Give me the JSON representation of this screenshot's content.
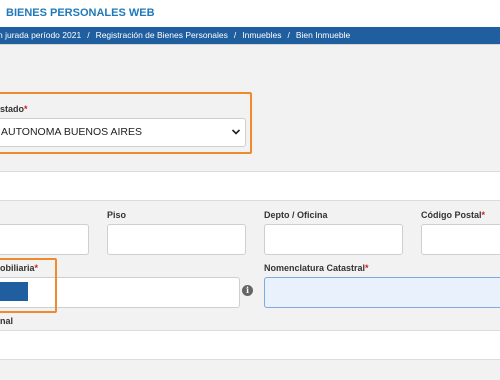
{
  "header": {
    "app_title": "BIENES PERSONALES WEB"
  },
  "breadcrumb": [
    "n jurada período 2021",
    "Registración de Bienes Personales",
    "Inmuebles",
    "Bien Inmueble"
  ],
  "breadcrumb_separator": "/",
  "form": {
    "estado": {
      "label": "stado",
      "required_mark": "*"
    },
    "provincia_select": {
      "value": "AUTONOMA BUENOS AIRES"
    },
    "piso": {
      "label": "Piso",
      "value": ""
    },
    "depto": {
      "label": "Depto / Oficina",
      "value": ""
    },
    "codigo_postal": {
      "label": "Código Postal",
      "required_mark": "*",
      "value": ""
    },
    "partida": {
      "label": "obiliaria",
      "required_mark": "*",
      "value": ""
    },
    "nomenclatura": {
      "label": "Nomenclatura Catastral",
      "required_mark": "*",
      "value": ""
    },
    "nal": {
      "label": "nal",
      "value": ""
    }
  },
  "icons": {
    "chevron": "chevron-down-icon",
    "info": "info-circle-icon",
    "info_glyph": "i"
  },
  "colors": {
    "brand_blue": "#1f5fa0",
    "title_blue": "#1e7ab8",
    "highlight_orange": "#ef8a2e",
    "required_red": "#d21c1c",
    "focus_field": "#e9f1fd"
  }
}
